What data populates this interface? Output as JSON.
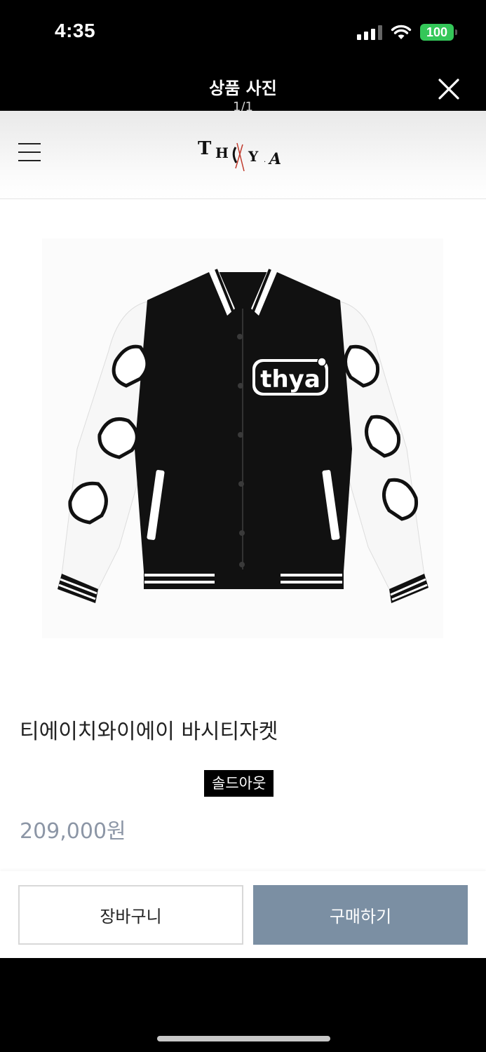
{
  "status_bar": {
    "time": "4:35",
    "battery": "100",
    "icons": [
      "signal-icon",
      "wifi-icon",
      "battery-icon"
    ]
  },
  "modal": {
    "title": "상품 사진",
    "counter": "1/1",
    "close_icon": "close-icon"
  },
  "site_header": {
    "menu_icon": "hamburger-menu-icon",
    "logo_text": "THYA"
  },
  "product": {
    "image_description_icon": "varsity-jacket-image",
    "chest_logo_text": "thya",
    "name": "티에이치와이에이 바시티자켓",
    "badge": "솔드아웃",
    "price": "209,000원"
  },
  "actions": {
    "cart_label": "장바구니",
    "buy_label": "구매하기"
  },
  "colors": {
    "buy_button": "#7b8fa3",
    "price_text": "#8c96a6",
    "battery": "#34c759"
  }
}
